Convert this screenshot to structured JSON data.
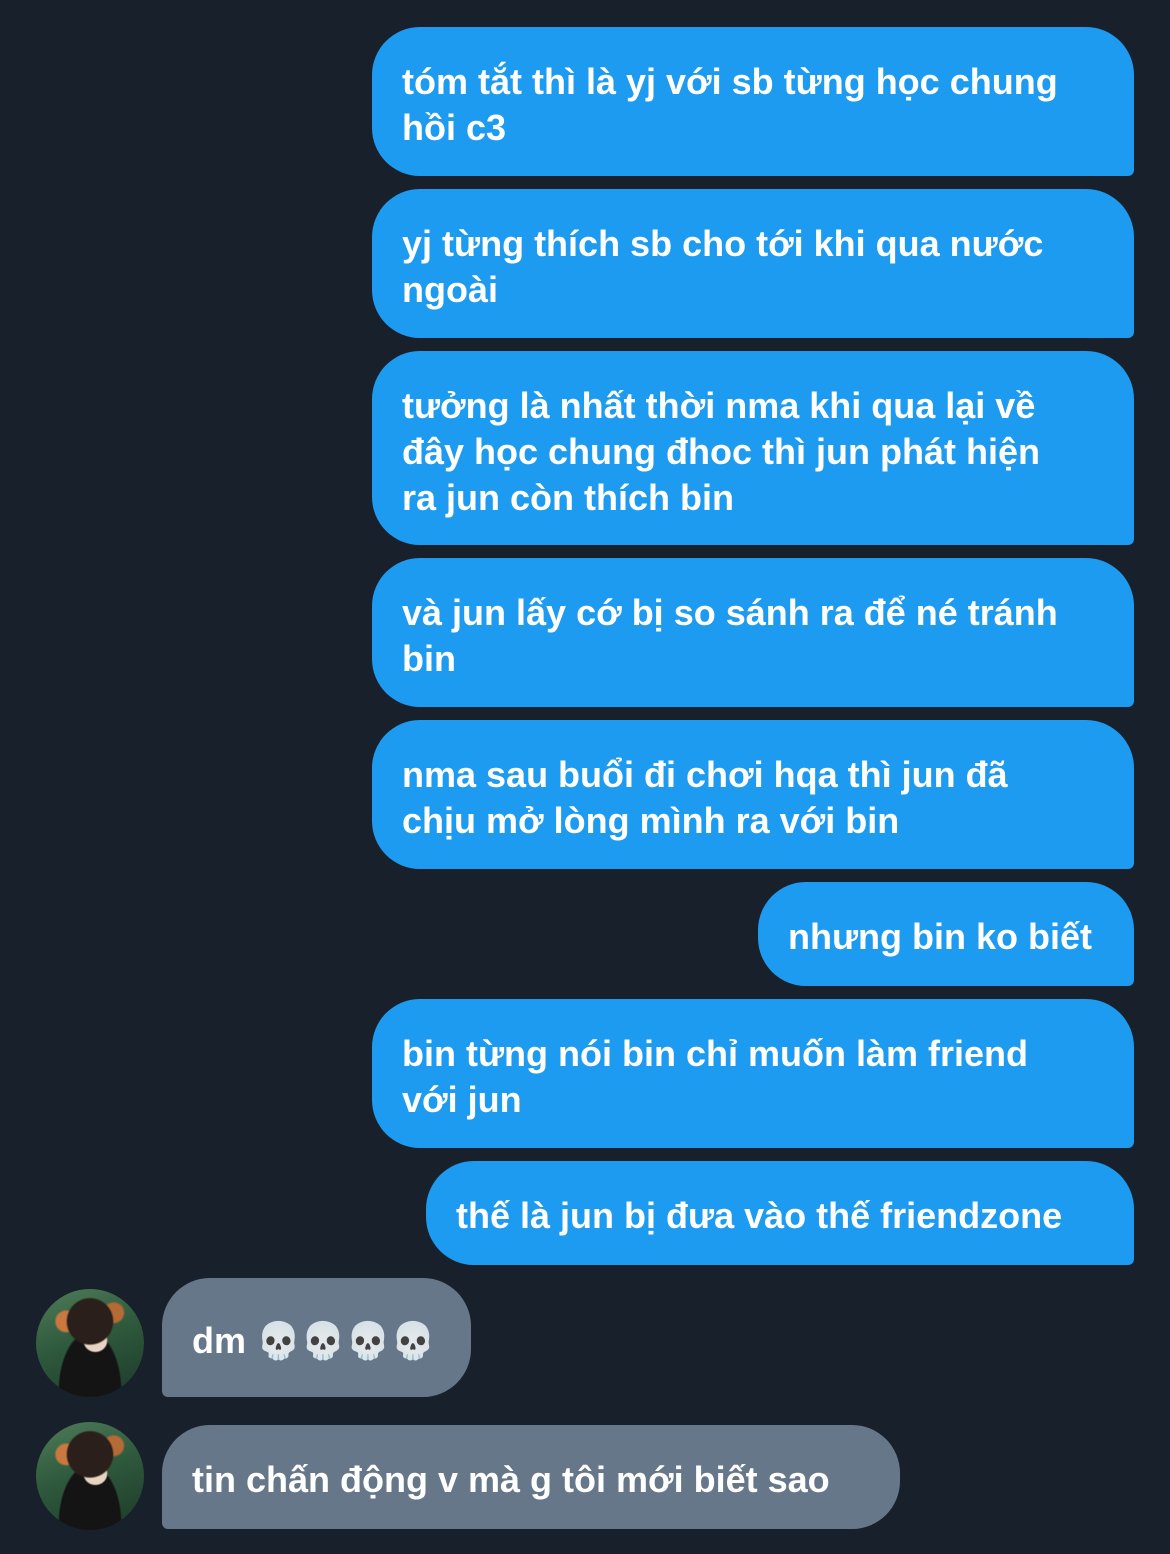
{
  "messages": [
    {
      "sender": "me",
      "text": "tóm tắt thì là yj với sb từng học chung\nhồi c3"
    },
    {
      "sender": "me",
      "text": "yj từng thích sb cho tới khi qua nước\nngoài"
    },
    {
      "sender": "me",
      "text": "tưởng là nhất thời nma khi qua lại về\nđây học chung đhoc thì jun phát hiện\nra jun còn thích bin"
    },
    {
      "sender": "me",
      "text": "và jun lấy cớ bị so sánh ra để né tránh\nbin"
    },
    {
      "sender": "me",
      "text": "nma sau buổi đi chơi hqa thì jun đã\nchịu mở lòng mình ra với bin"
    },
    {
      "sender": "me",
      "text": "nhưng bin ko biết"
    },
    {
      "sender": "me",
      "text": "bin từng nói bin chỉ muốn làm friend\nvới jun"
    },
    {
      "sender": "me",
      "text": "thế là jun bị đưa vào thế friendzone"
    },
    {
      "sender": "them",
      "text": "dm 💀💀💀💀"
    },
    {
      "sender": "them",
      "text": "tin chấn động v mà g tôi mới biết sao"
    }
  ],
  "colors": {
    "background": "#18202b",
    "sent_bubble": "#1d9bf0",
    "received_bubble": "#67778a",
    "text": "#ffffff"
  }
}
